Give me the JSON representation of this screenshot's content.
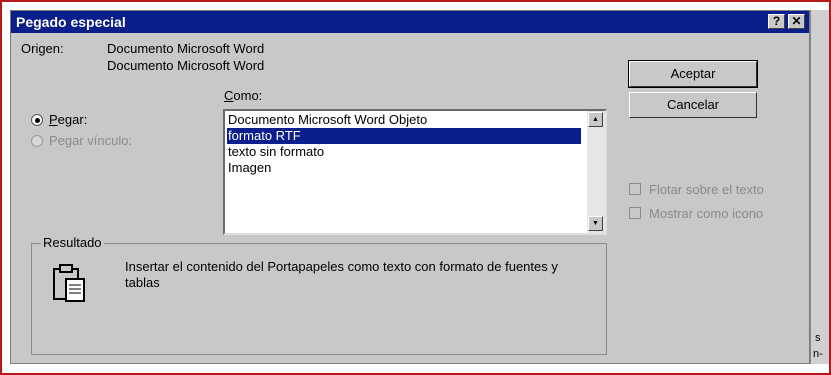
{
  "dialog": {
    "title": "Pegado especial",
    "help_btn": "?",
    "close_btn": "✕"
  },
  "source": {
    "label": "Origen:",
    "line1": "Documento Microsoft Word",
    "line2": "Documento Microsoft Word"
  },
  "como": {
    "label_first": "C",
    "label_rest": "omo:"
  },
  "options": {
    "paste_first": "P",
    "paste_rest": "egar:",
    "paste_link": "Pegar vínculo:"
  },
  "list": {
    "items": [
      "Documento Microsoft Word Objeto",
      "formato RTF",
      "texto sin formato",
      "Imagen"
    ],
    "selected_index": 1
  },
  "buttons": {
    "accept": "Aceptar",
    "cancel": "Cancelar"
  },
  "checks": {
    "float": "Flotar sobre el texto",
    "icon": "Mostrar como icono"
  },
  "result": {
    "title": "Resultado",
    "text": "Insertar el contenido del Portapapeles como texto con formato de fuentes y tablas"
  },
  "background": {
    "fragment1": "s",
    "fragment2": "n-"
  },
  "colors": {
    "title_bar": "#0a1f8c",
    "selection": "#0a1f8c",
    "dialog_bg": "#c8c8c8",
    "frame_border": "#b51818"
  }
}
